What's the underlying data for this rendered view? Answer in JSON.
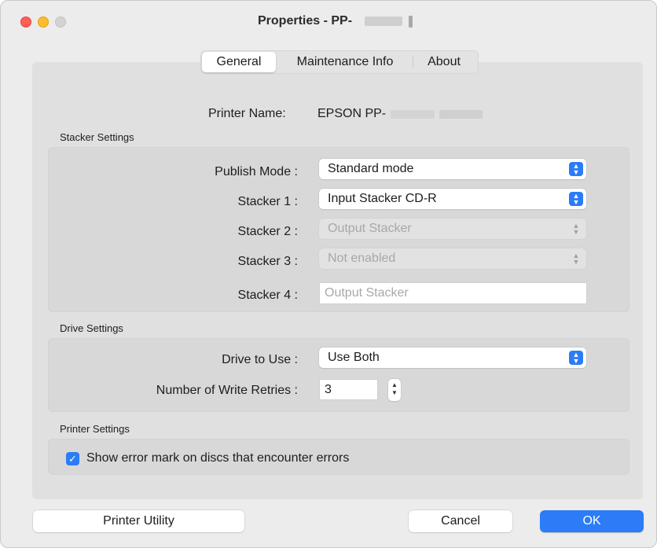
{
  "window": {
    "title": "Properties - PP-",
    "traffic_lights": [
      "close",
      "minimize",
      "zoom"
    ]
  },
  "tabs": [
    {
      "label": "General",
      "selected": true
    },
    {
      "label": "Maintenance Info",
      "selected": false
    },
    {
      "label": "About",
      "selected": false
    }
  ],
  "printer_name": {
    "label": "Printer Name:",
    "value": "EPSON PP-"
  },
  "stacker_settings": {
    "section_label": "Stacker Settings",
    "publish_mode": {
      "label": "Publish Mode :",
      "value": "Standard mode",
      "enabled": true
    },
    "stacker1": {
      "label": "Stacker 1 :",
      "value": "Input Stacker CD-R",
      "enabled": true
    },
    "stacker2": {
      "label": "Stacker 2 :",
      "value": "Output Stacker",
      "enabled": false
    },
    "stacker3": {
      "label": "Stacker 3 :",
      "value": "Not enabled",
      "enabled": false
    },
    "stacker4": {
      "label": "Stacker 4 :",
      "placeholder": "Output Stacker"
    }
  },
  "drive_settings": {
    "section_label": "Drive Settings",
    "drive_to_use": {
      "label": "Drive to Use :",
      "value": "Use Both"
    },
    "write_retries": {
      "label": "Number of Write Retries :",
      "value": "3"
    }
  },
  "printer_settings": {
    "section_label": "Printer Settings",
    "show_error_mark": {
      "label": "Show error mark on discs that encounter errors",
      "checked": true
    }
  },
  "buttons": {
    "printer_utility": "Printer Utility",
    "cancel": "Cancel",
    "ok": "OK"
  },
  "colors": {
    "accent": "#2b7cf6",
    "close": "#fe5f57",
    "minimize": "#febc2e",
    "zoom_inactive": "#d3d3d3"
  }
}
